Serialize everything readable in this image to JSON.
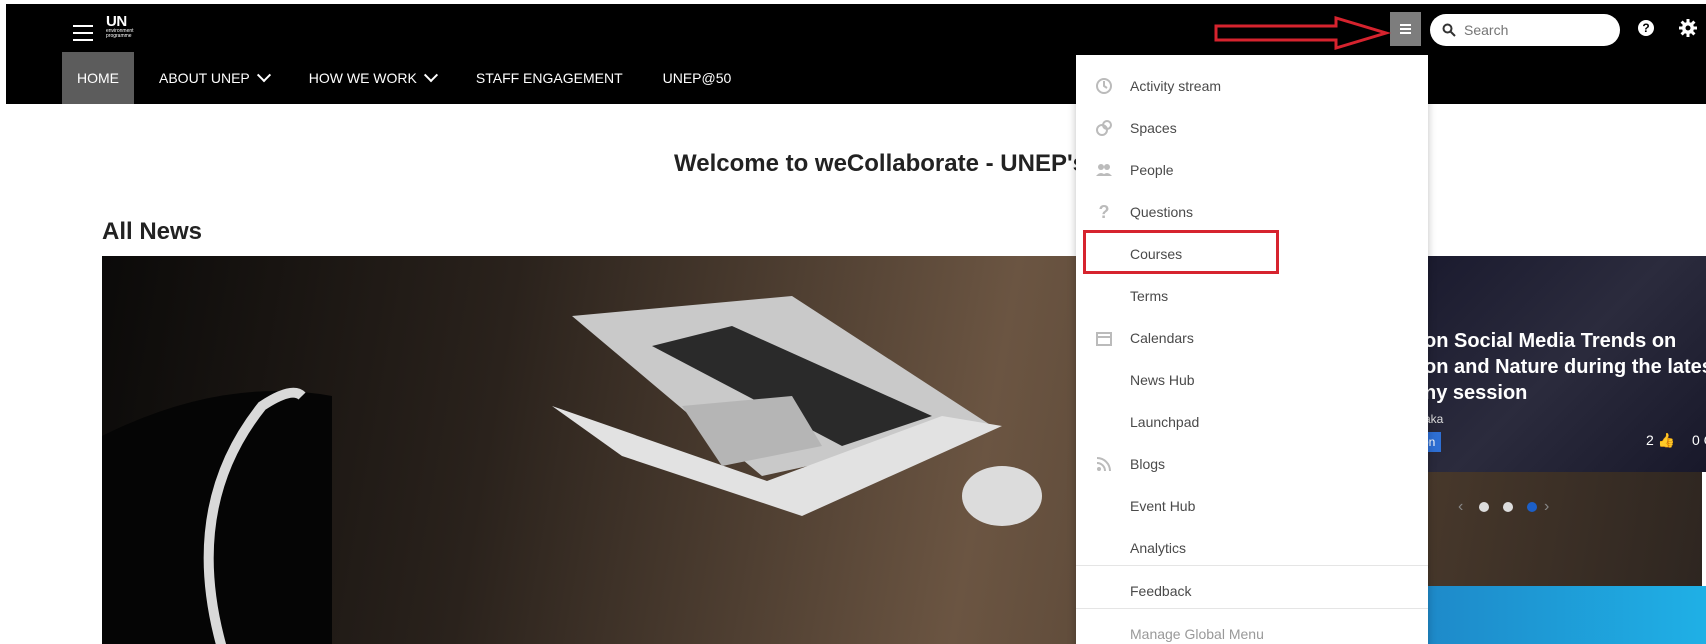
{
  "brand": {
    "logo_text": "UN",
    "logo_sub": "environment programme"
  },
  "nav": {
    "items": [
      {
        "label": "HOME"
      },
      {
        "label": "ABOUT UNEP"
      },
      {
        "label": "HOW WE WORK"
      },
      {
        "label": "STAFF ENGAGEMENT"
      },
      {
        "label": "UNEP@50"
      }
    ]
  },
  "search": {
    "placeholder": "Search"
  },
  "page": {
    "welcome": "Welcome to weCollaborate - UNEP's",
    "section_title": "All News",
    "section_title_2_fragment": "s"
  },
  "slide": {
    "title": "on Social Media Trends on on and Nature during the latest ny session",
    "title_lines": [
      "on Social Media Trends on",
      "on and Nature during the latest",
      "ny session"
    ],
    "author_fragment": "aka",
    "tag_fragment": "on",
    "likes": "2",
    "comments_fragment": "0 C"
  },
  "carousel": {
    "dots": 3,
    "active_index": 2
  },
  "dropdown": {
    "items": [
      {
        "label": "Activity stream",
        "icon": "clock-icon"
      },
      {
        "label": "Spaces",
        "icon": "spaces-icon"
      },
      {
        "label": "People",
        "icon": "people-icon"
      },
      {
        "label": "Questions",
        "icon": "question-icon"
      },
      {
        "label": "Courses",
        "icon": ""
      },
      {
        "label": "Terms",
        "icon": ""
      },
      {
        "label": "Calendars",
        "icon": "calendar-icon"
      },
      {
        "label": "News Hub",
        "icon": ""
      },
      {
        "label": "Launchpad",
        "icon": ""
      },
      {
        "label": "Blogs",
        "icon": "blogs-icon"
      },
      {
        "label": "Event Hub",
        "icon": ""
      },
      {
        "label": "Analytics",
        "icon": ""
      }
    ],
    "feedback": "Feedback",
    "manage": "Manage Global Menu"
  },
  "colors": {
    "topbar": "#000000",
    "active_nav": "#5c5c5c",
    "annotation_red": "#d6232e",
    "carousel_active": "#1c5fc7"
  }
}
